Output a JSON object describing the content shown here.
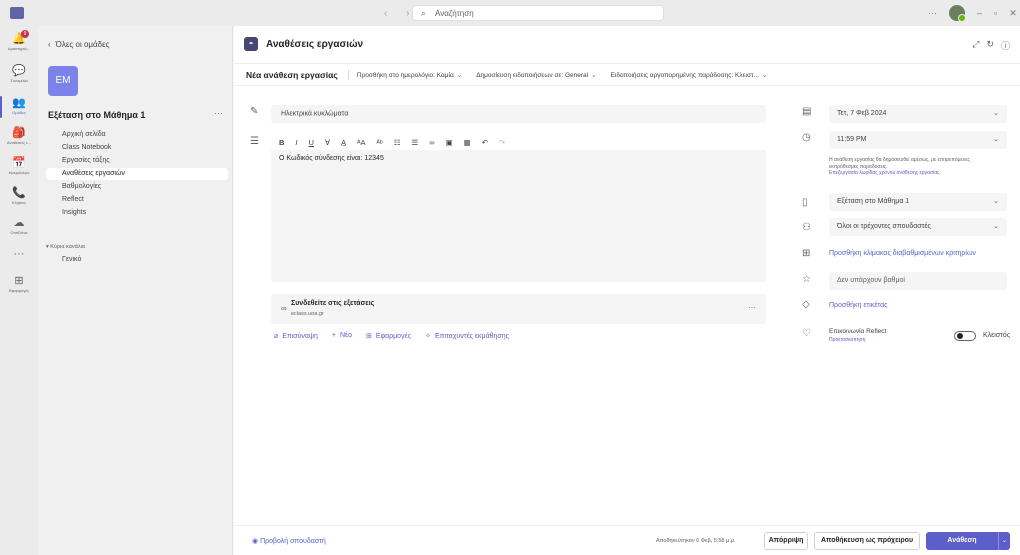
{
  "titlebar": {
    "search_placeholder": "Αναζήτηση",
    "nav_arrows": "‹ ›",
    "more": "···",
    "minimize": "–",
    "restore": "▫",
    "close": "✕"
  },
  "rail": {
    "items": [
      {
        "label": "Δραστηριό...",
        "icon": "bell-icon",
        "glyph": "🔔"
      },
      {
        "label": "Συνομιλία",
        "icon": "chat-icon",
        "glyph": "💬"
      },
      {
        "label": "Ομάδες",
        "icon": "teams-icon",
        "glyph": "👥"
      },
      {
        "label": "Αναθέσεις ε...",
        "icon": "assignments-icon",
        "glyph": "🎒"
      },
      {
        "label": "Ημερολόγιο",
        "icon": "calendar-icon",
        "glyph": "📅"
      },
      {
        "label": "Κλήσεις",
        "icon": "calls-icon",
        "glyph": "📞"
      },
      {
        "label": "OneDrive",
        "icon": "onedrive-icon",
        "glyph": "☁"
      },
      {
        "label": "",
        "icon": "more-icon",
        "glyph": "···"
      },
      {
        "label": "Εφαρμογές",
        "icon": "apps-icon",
        "glyph": "⊞"
      }
    ],
    "activity_badge": "9"
  },
  "sidepanel": {
    "back_label": "Όλες οι ομάδες",
    "team_initials": "EM",
    "team_name": "Εξέταση στο Μάθημα 1",
    "more": "···",
    "channels": [
      "Αρχική σελίδα",
      "Class Notebook",
      "Εργασίες τάξης",
      "Αναθέσεις εργασιών",
      "Βαθμολογίες",
      "Reflect",
      "Insights"
    ],
    "section_label": "▾ Κύρια κανάλια",
    "section_channel": "Γενικό"
  },
  "main": {
    "title": "Αναθέσεις εργασιών",
    "tabs": {
      "main": "Νέα ανάθεση εργασίας",
      "opts": [
        "Προσθήκη στο ημερολόγιο: Καμία",
        "Δημοσίευση ειδοποιήσεων σε: General",
        "Ειδοποιήσεις αργοπορημένης παράδοσης: Κλειστ..."
      ]
    },
    "assignment_title": "Ηλεκτρικά κυκλώματα",
    "editor_text": "Ο Κωδικός σύνδεσης είναι: 12345",
    "link_card": {
      "title": "Συνδεθείτε στις εξετάσεις",
      "url": "eclass.uoa.gr",
      "more": "···"
    },
    "attach": [
      "Επισύναψη",
      "Νέο",
      "Εφαρμογές",
      "Επιταχυντές εκμάθησης"
    ]
  },
  "right": {
    "date": "Τετ, 7 Φεβ 2024",
    "time": "11:59 PM",
    "note_line1": "Η ανάθεση εργασίας θα δημοσιευθεί αμέσως, με επιτρεπόμενες",
    "note_line2": "εκπρόθεσμες παραδόσεις.",
    "note_link": "Επεξεργασία λωρίδας χρόνου ανάθεσης εργασίας",
    "class": "Εξέταση στο Μάθημα 1",
    "students": "Όλοι οι τρέχοντες σπουδαστές",
    "rubric_link": "Προσθήκη κλίμακας διαβαθμισμένων κριτηρίων",
    "points": "Δεν υπάρχουν βαθμοί",
    "tag_link": "Προσθήκη ετικέτας",
    "reflect_label": "Επικοινωνία Reflect",
    "reflect_sub": "Προεπισκόπηση",
    "toggle_label": "Κλειστός"
  },
  "footer": {
    "preview": "Προβολή σπουδαστή",
    "saved": "Αποθηκεύτηκαν 6 Φεβ, 5:58 μ.μ.",
    "discard": "Απόρριψη",
    "save_draft": "Αποθήκευση ως πρόχειρου",
    "assign": "Ανάθεση"
  },
  "colors": {
    "accent": "#5b5fc7",
    "team_avatar": "#7b83eb",
    "badge": "#c4314b"
  }
}
